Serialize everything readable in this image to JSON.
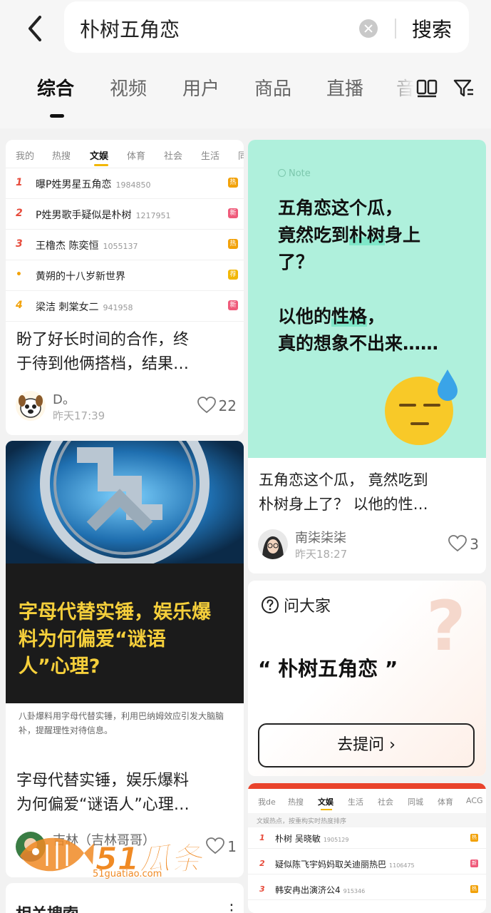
{
  "search": {
    "query": "朴树五角恋",
    "button_label": "搜索"
  },
  "tabs": [
    "综合",
    "视频",
    "用户",
    "商品",
    "直播",
    "音"
  ],
  "card1": {
    "hot_tabs": [
      "我的",
      "热搜",
      "文娱",
      "体育",
      "社会",
      "生活",
      "同"
    ],
    "rows": [
      {
        "rank": "1",
        "text": "曝P姓男星五角恋",
        "count": "1984850",
        "badge": "热",
        "badge_color": "#f2a20a"
      },
      {
        "rank": "2",
        "text": "P姓男歌手疑似是朴树",
        "count": "1217951",
        "badge": "新",
        "badge_color": "#ef5a7a"
      },
      {
        "rank": "3",
        "text": "王橹杰 陈奕恒",
        "count": "1055137",
        "badge": "热",
        "badge_color": "#f2a20a"
      },
      {
        "rank": "•",
        "text": "黄朔的十八岁新世界",
        "count": "",
        "badge": "荐",
        "badge_color": "#f2b705"
      },
      {
        "rank": "4",
        "text": "梁洁 刺棠女二",
        "count": "941958",
        "badge": "新",
        "badge_color": "#ef5a7a"
      }
    ],
    "title": "盼了好长时间的合作，终于待到他俩搭档，结果…",
    "title_line1": "盼了好长时间的合作，终",
    "title_line2": "于待到他俩搭档，结果…",
    "author": "D。",
    "time": "昨天17:39",
    "likes": "22"
  },
  "card2": {
    "note_label": "Note",
    "lines": [
      "五角恋这个瓜，",
      "竟然吃到朴树身上",
      "了？",
      "以他的性格，",
      "真的想象不出来……"
    ],
    "title_line1": "五角恋这个瓜， 竟然吃到",
    "title_line2": "朴树身上了？ 以他的性…",
    "author": "南柒柒柒",
    "time": "昨天18:27",
    "likes": "3"
  },
  "card3": {
    "headline_lines": [
      "字母代替实锤，娱乐爆",
      "料为何偏爱“谜语",
      "人”心理?"
    ],
    "summary": "八卦爆料用字母代替实锤，利用巴纳姆效应引发大脑脑补，提醒理性对待信息。",
    "title_line1": "字母代替实锤，娱乐爆料",
    "title_line2": "为何偏爱“谜语人”心理…",
    "author": "吉林（吉林哥哥）",
    "likes": "1"
  },
  "card4": {
    "header": "问大家",
    "quote": "“ 朴树五角恋 ”",
    "button": "去提问 ›"
  },
  "card5": {
    "tabs": [
      "我de",
      "热搜",
      "文娱",
      "生活",
      "社会",
      "同城",
      "体育",
      "ACG"
    ],
    "hint": "文娱热点，按重构实时热度排序",
    "rows": [
      {
        "rank": "1",
        "text": "朴树 吴晓敏",
        "count": "1905129",
        "badge": "热",
        "badge_color": "#f2a20a"
      },
      {
        "rank": "2",
        "text": "疑似陈飞宇妈妈取关迪丽热巴",
        "count": "1106475",
        "badge": "新",
        "badge_color": "#ef5a7a"
      },
      {
        "rank": "3",
        "text": "韩安冉出演济公4",
        "count": "915346",
        "badge": "热",
        "badge_color": "#f2a20a"
      }
    ]
  },
  "card6": {
    "title": "相关搜索",
    "more": "⋮"
  },
  "watermark": {
    "brand": "51瓜条",
    "url": "51guatiao.com"
  }
}
